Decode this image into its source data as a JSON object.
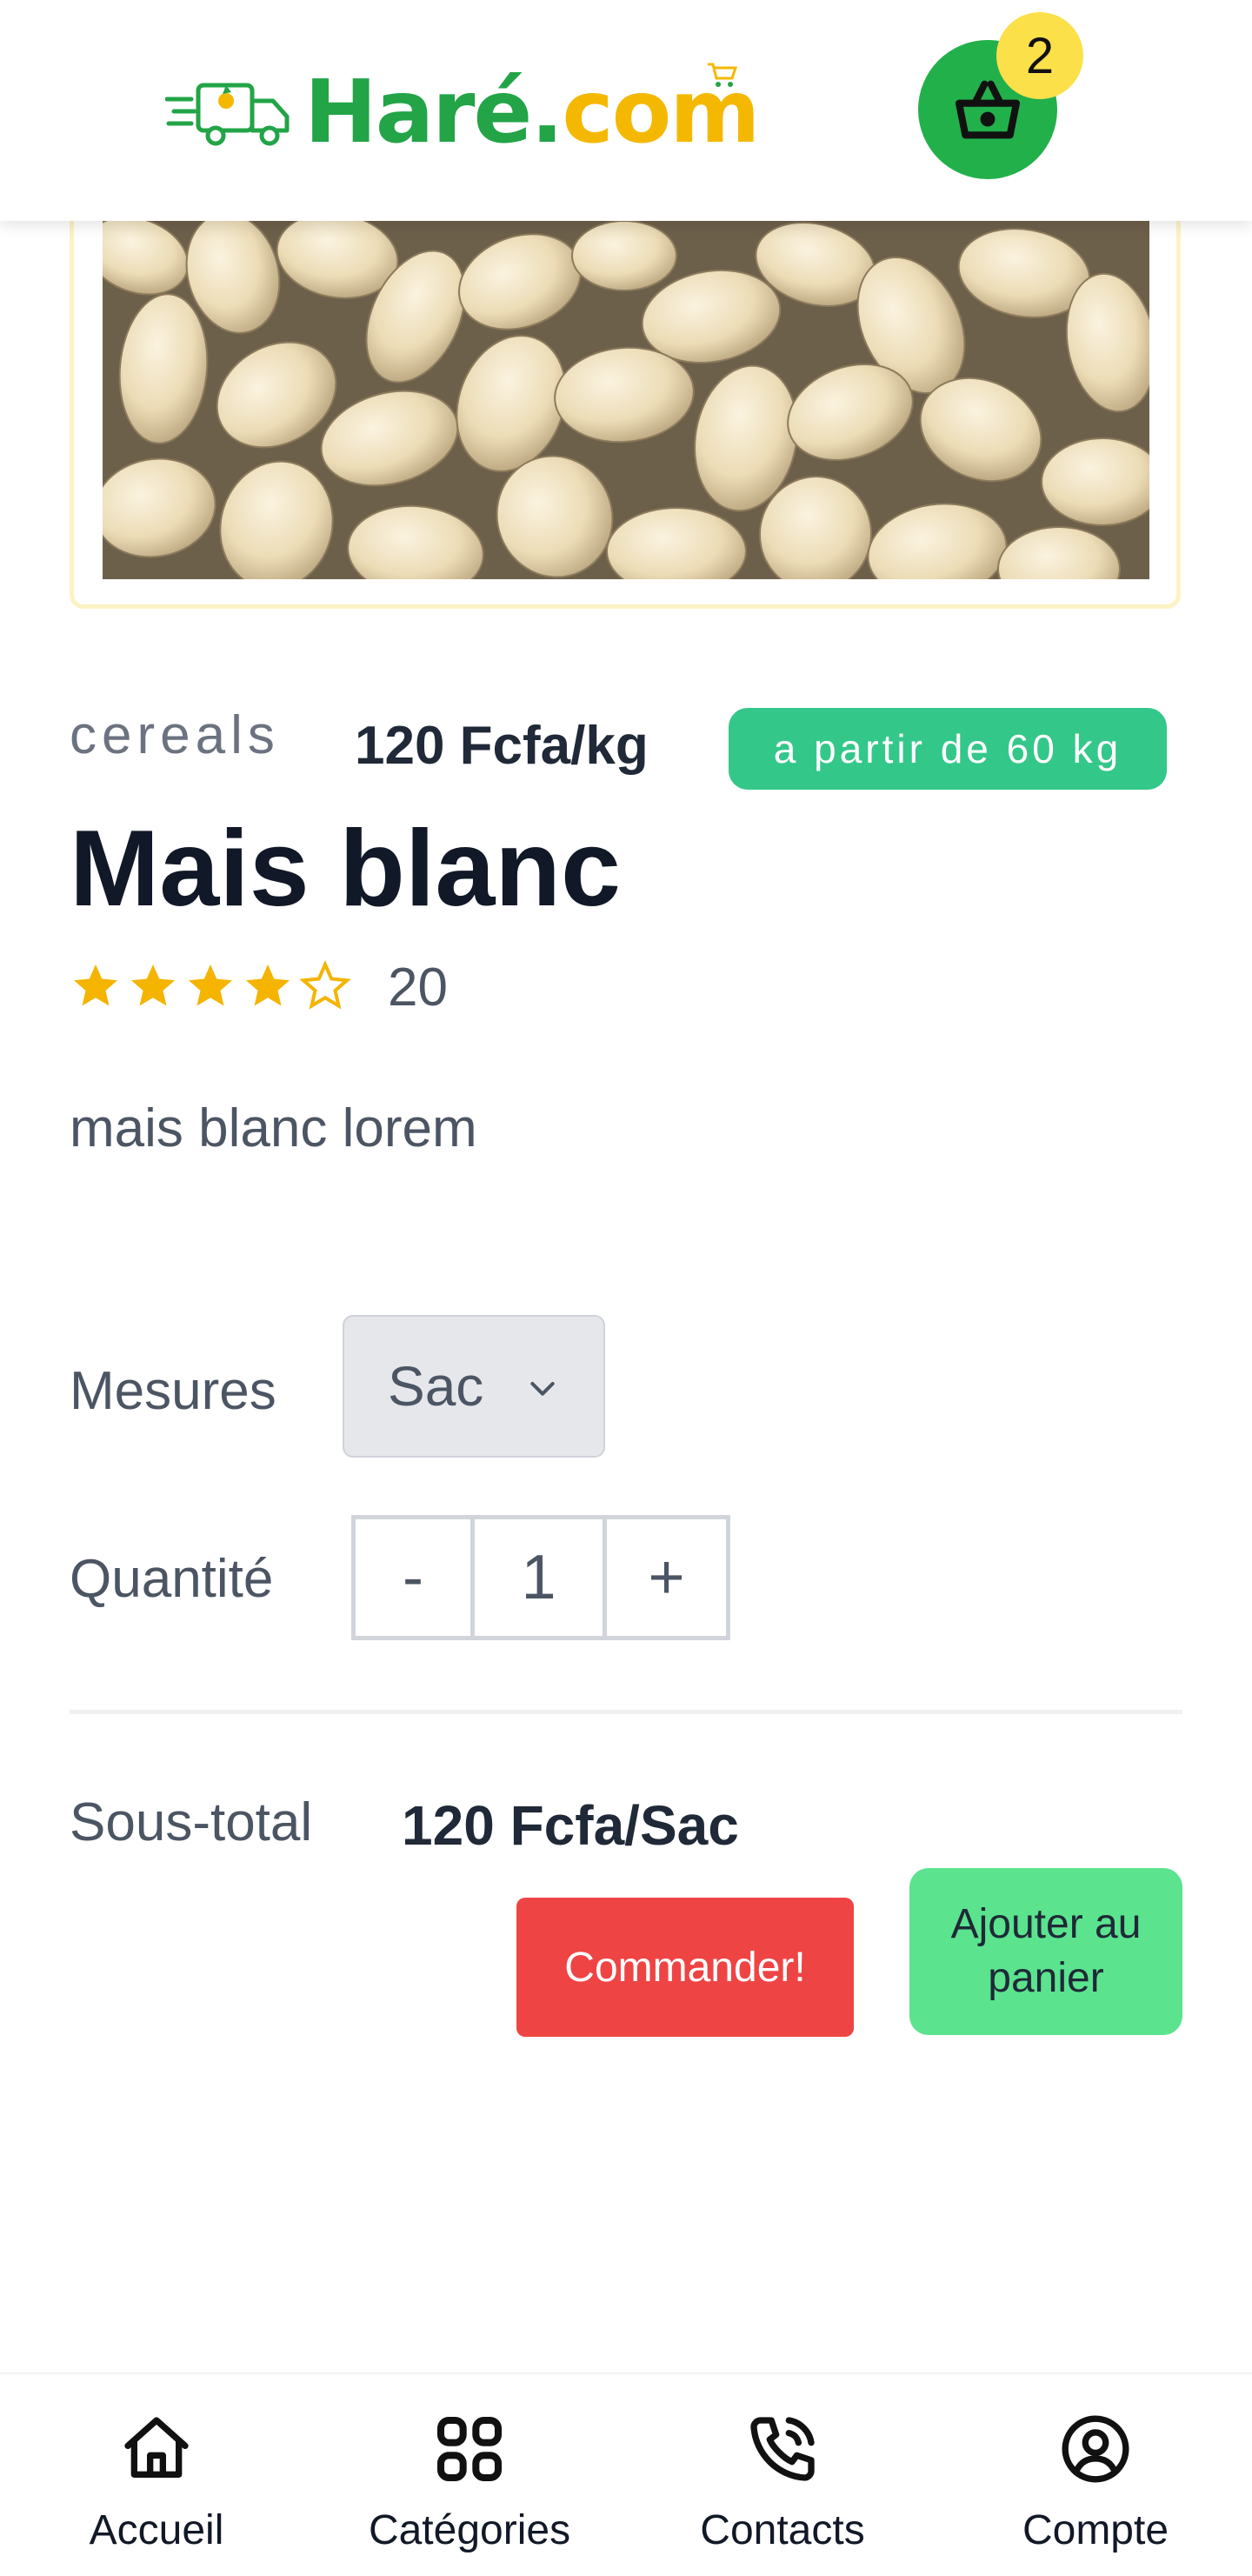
{
  "header": {
    "logo_text_main": "Haré",
    "logo_text_dot": ".",
    "logo_text_suffix": "com",
    "cart_count": "2",
    "cart_icon": "basket-icon",
    "brand_green": "#22a447",
    "brand_yellow": "#f5b800"
  },
  "product": {
    "category": "cereals",
    "price": "120 Fcfa/kg",
    "min_quantity_badge": "a partir de 60 kg",
    "title": "Mais blanc",
    "rating": 4,
    "rating_max": 5,
    "rating_count": "20",
    "description": "mais blanc lorem"
  },
  "options": {
    "measures_label": "Mesures",
    "measures_selected": "Sac",
    "quantity_label": "Quantité",
    "decrement": "-",
    "quantity_value": "1",
    "increment": "+"
  },
  "summary": {
    "subtotal_label": "Sous-total",
    "subtotal_value": "120 Fcfa/Sac",
    "order_button": "Commander!",
    "add_to_cart_button": "Ajouter au panier",
    "order_color": "#ef4444",
    "add_color": "#5be38e"
  },
  "bottom_nav": {
    "items": [
      {
        "label": "Accueil",
        "icon": "home-icon"
      },
      {
        "label": "Catégories",
        "icon": "grid-icon"
      },
      {
        "label": "Contacts",
        "icon": "phone-icon"
      },
      {
        "label": "Compte",
        "icon": "user-circle-icon"
      }
    ]
  }
}
